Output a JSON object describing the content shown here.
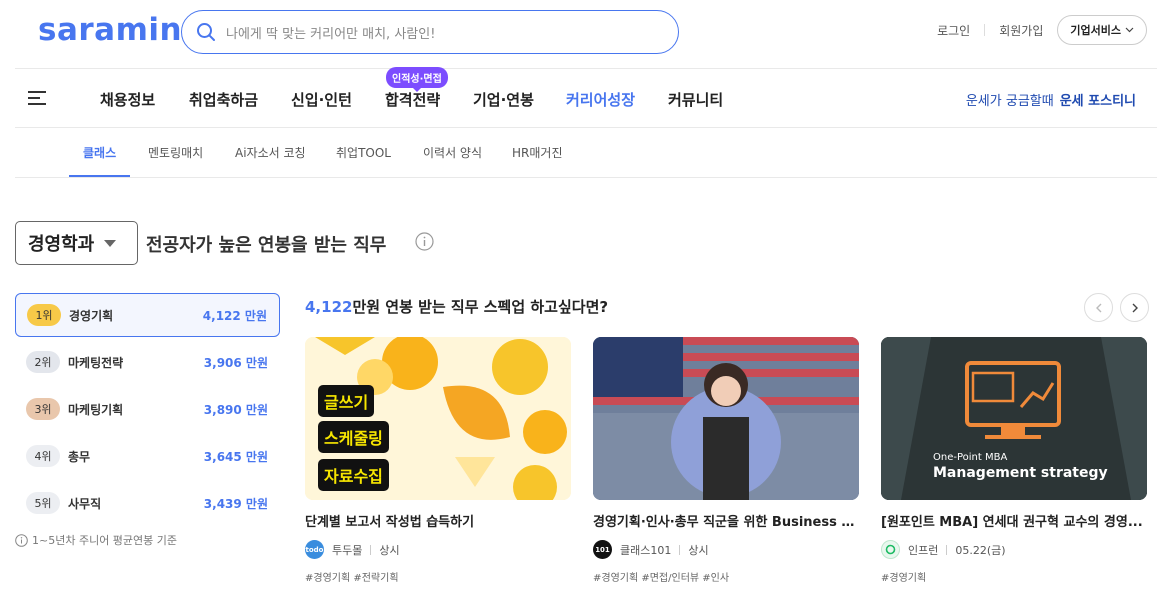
{
  "header": {
    "logo": "saramin",
    "search_placeholder": "나에게 딱 맞는 커리어만 매치, 사람인!",
    "login": "로그인",
    "signup": "회원가입",
    "corp_service": "기업서비스"
  },
  "gnb": {
    "items": [
      "채용정보",
      "취업축하금",
      "신입·인턴",
      "합격전략",
      "기업·연봉",
      "커리어성장",
      "커뮤니티"
    ],
    "badge": "인적성·면접",
    "right_text1": "운세가 궁금할때",
    "right_text2": "운세 포스티니"
  },
  "subnav": {
    "items": [
      "클래스",
      "멘토링매치",
      "Ai자소서 코칭",
      "취업TOOL",
      "이력서 양식",
      "HR매거진"
    ]
  },
  "main": {
    "major": "경영학과",
    "title": "전공자가 높은 연봉을 받는 직무",
    "note": "1~5년차 주니어 평균연봉 기준",
    "ranks": [
      {
        "rank": "1위",
        "name": "경영기획",
        "salary": "4,122 만원",
        "badge_color": "#f7c948"
      },
      {
        "rank": "2위",
        "name": "마케팅전략",
        "salary": "3,906 만원",
        "badge_color": "#e3e6ec"
      },
      {
        "rank": "3위",
        "name": "마케팅기획",
        "salary": "3,890 만원",
        "badge_color": "#e9c7ac"
      },
      {
        "rank": "4위",
        "name": "총무",
        "salary": "3,645 만원",
        "badge_color": "#eceef2"
      },
      {
        "rank": "5위",
        "name": "사무직",
        "salary": "3,439 만원",
        "badge_color": "#eceef2"
      }
    ],
    "promo_highlight": "4,122",
    "promo_text": "만원 연봉 받는 직무 스펙업 하고싶다면?"
  },
  "cards": [
    {
      "title": "단계별 보고서 작성법 습득하기",
      "provider": "투두몰",
      "provider_logo_text": "todo",
      "period": "상시",
      "tags": "#경영기획 #전략기획",
      "thumb_tags": [
        "글쓰기",
        "스케줄링",
        "자료수집"
      ]
    },
    {
      "title": "경영기획·인사·총무 직군을 위한 Business I...",
      "provider": "클래스101",
      "provider_logo_text": "101",
      "period": "상시",
      "tags": "#경영기획 #면접/인터뷰 #인사"
    },
    {
      "title": "[원포인트 MBA] 연세대 권구혁 교수의 경영...",
      "provider": "인프런",
      "provider_logo_text": "",
      "period": "05.22(금)",
      "tags": "#경영기획",
      "thumb_line1": "One-Point MBA",
      "thumb_line2": "Management strategy"
    }
  ],
  "colors": {
    "brand": "#4876ef",
    "badge_purple": "#7c4dff",
    "dark_link": "#1f4ab0"
  },
  "icons": [
    "search-icon",
    "chevron-down-icon",
    "hamburger-icon",
    "info-icon",
    "arrow-left-icon",
    "arrow-right-icon"
  ]
}
